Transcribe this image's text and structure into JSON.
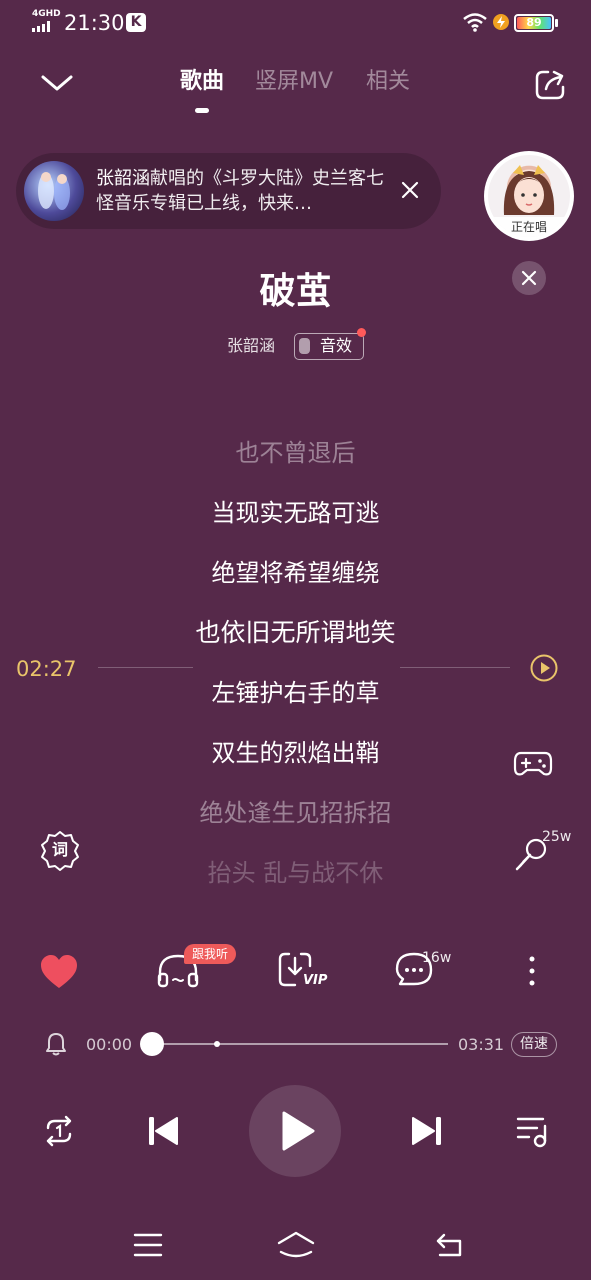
{
  "status_bar": {
    "network": "4GHD",
    "time": "21:30",
    "app_badge": "K",
    "battery": "89"
  },
  "header": {
    "tabs": [
      {
        "label": "歌曲",
        "active": true
      },
      {
        "label": "竖屏MV",
        "active": false
      },
      {
        "label": "相关",
        "active": false
      }
    ]
  },
  "banner": {
    "highlight": "张韶涵",
    "text": "献唱的《斗罗大陆》史兰客七怪音乐专辑已上线，快来…"
  },
  "singing_badge": {
    "label": "正在唱"
  },
  "song": {
    "title": "破茧",
    "artist": "张韶涵",
    "effect_label": "音效"
  },
  "lyrics": [
    {
      "text": "也不曾退后",
      "state": "dim"
    },
    {
      "text": "当现实无路可逃",
      "state": "normal"
    },
    {
      "text": "绝望将希望缠绕",
      "state": "normal"
    },
    {
      "text": "也依旧无所谓地笑",
      "state": "active"
    },
    {
      "text": "左锤护右手的草",
      "state": "normal"
    },
    {
      "text": "双生的烈焰出鞘",
      "state": "normal"
    },
    {
      "text": "绝处逢生见招拆招",
      "state": "dim"
    },
    {
      "text": "抬头 乱与战不休",
      "state": "fade"
    }
  ],
  "lyric_seek": {
    "time": "02:27"
  },
  "side_tools": {
    "lyric_icon_label": "词",
    "karaoke_count": "25w"
  },
  "actions": {
    "follow_badge": "跟我听",
    "download_label": "VIP",
    "comment_count": "16w"
  },
  "progress": {
    "current": "00:00",
    "total": "03:31",
    "fraction": 0.0,
    "speed_label": "倍速"
  },
  "colors": {
    "background": "#56294a",
    "accent_time": "#e9c46a",
    "heart": "#ee4f5f"
  }
}
